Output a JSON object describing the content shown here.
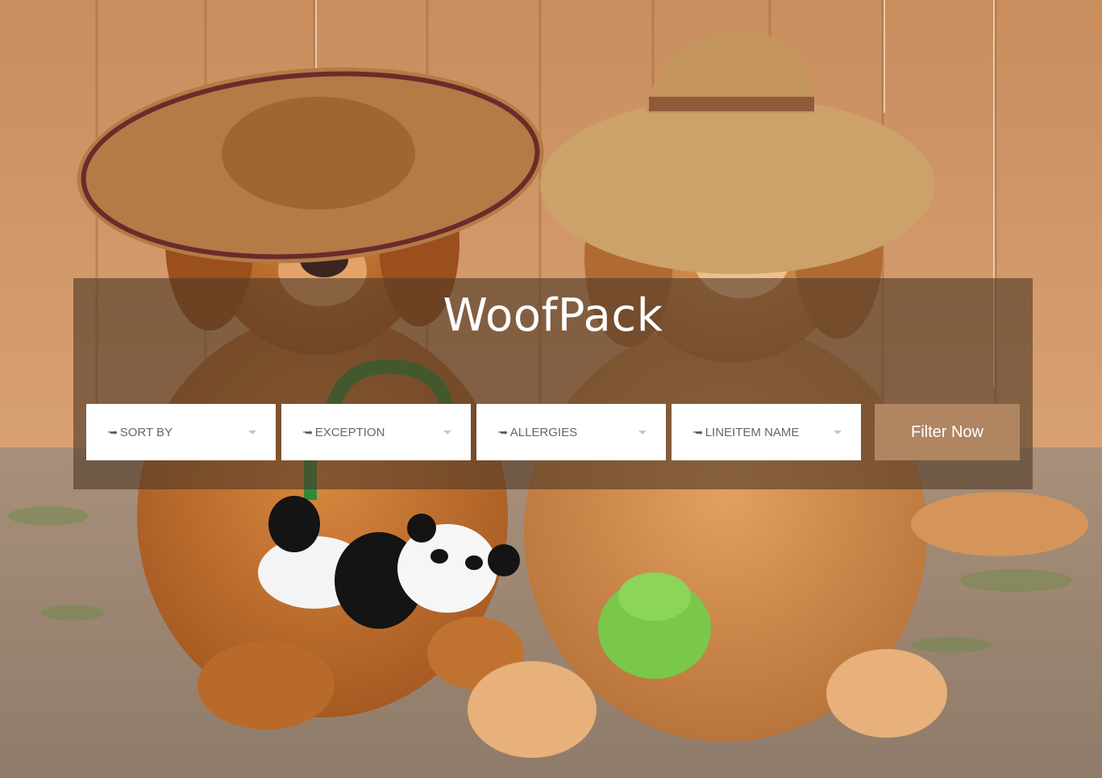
{
  "brand": {
    "title": "WoofPack"
  },
  "filters": [
    {
      "label": "SORT BY",
      "icon": "arrow-right-icon"
    },
    {
      "label": "EXCEPTION",
      "icon": "arrow-right-icon"
    },
    {
      "label": "ALLERGIES",
      "icon": "arrow-right-icon"
    },
    {
      "label": "LINEITEM NAME",
      "icon": "arrow-right-icon"
    }
  ],
  "filter_button": {
    "label": "Filter Now"
  },
  "colors": {
    "panel_overlay": "#503a28",
    "button": "#b08562",
    "select_bg": "#ffffff",
    "select_text": "#666666"
  }
}
